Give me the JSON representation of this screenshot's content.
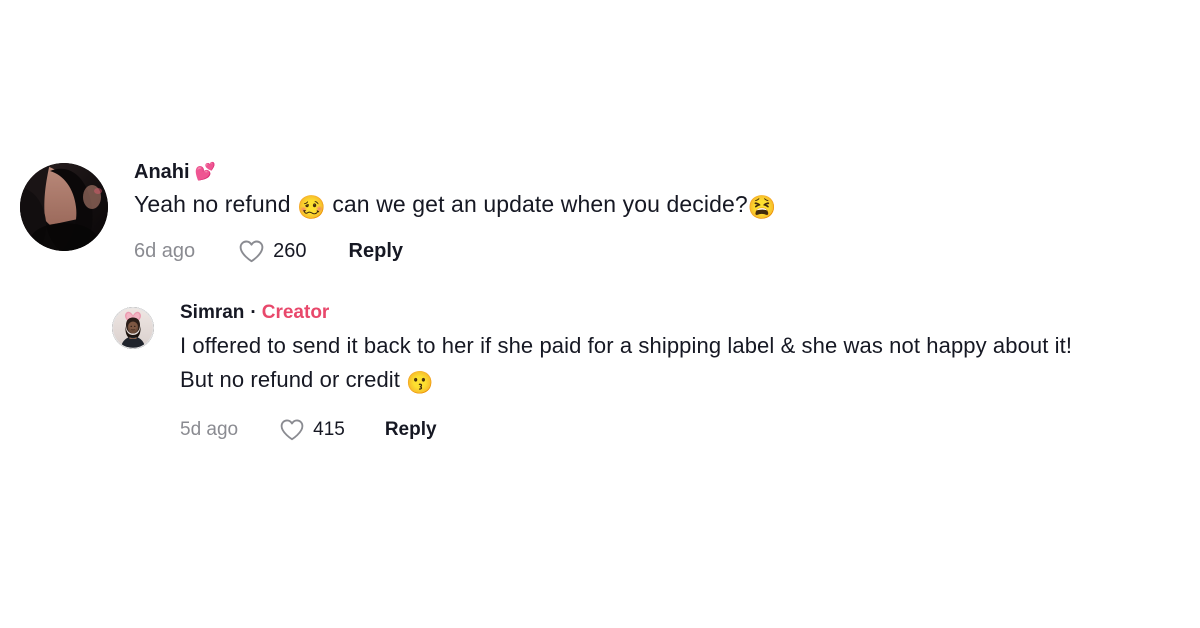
{
  "theme": {
    "background": "#ffffff",
    "text_primary": "#161823",
    "text_muted": "#8a8b91",
    "creator_badge_color": "#e8486b"
  },
  "comments": [
    {
      "id": "root-comment",
      "avatar": "anahi-avatar",
      "username": "Anahi",
      "name_emoji": "💕",
      "text_before_emoji": "Yeah no refund ",
      "emoji_1": "🥴",
      "text_after_emoji": " can we get an update when you decide?",
      "emoji_2": "😫",
      "timestamp": "6d ago",
      "like_count": "260",
      "reply_label": "Reply"
    },
    {
      "id": "reply-comment",
      "avatar": "simran-avatar",
      "username": "Simran",
      "separator": "·",
      "badge": "Creator",
      "text": "I offered to send it back to her if she paid for a shipping label & she was not happy about it! But no refund or credit ",
      "emoji_1": "😗",
      "timestamp": "5d ago",
      "like_count": "415",
      "reply_label": "Reply"
    }
  ]
}
